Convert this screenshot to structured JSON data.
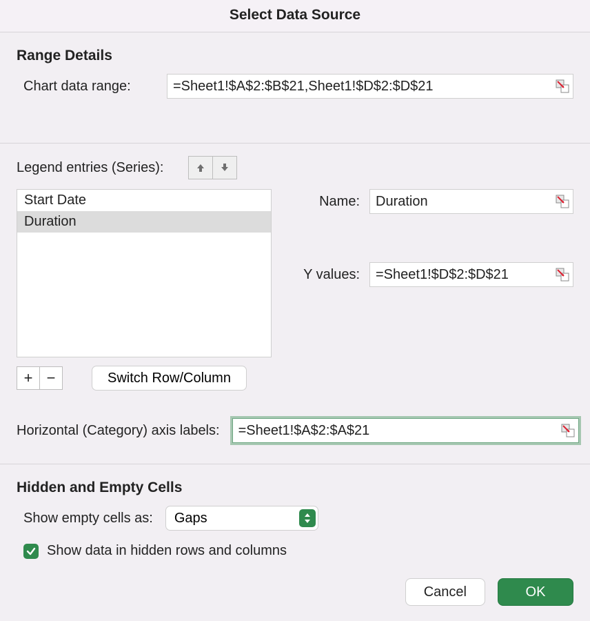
{
  "dialog": {
    "title": "Select Data Source"
  },
  "range_details": {
    "heading": "Range Details",
    "chart_data_range_label": "Chart data range:",
    "chart_data_range_value": "=Sheet1!$A$2:$B$21,Sheet1!$D$2:$D$21"
  },
  "legend": {
    "heading": "Legend entries (Series):",
    "items": [
      {
        "label": "Start Date",
        "selected": false
      },
      {
        "label": "Duration",
        "selected": true
      }
    ],
    "add_label": "+",
    "remove_label": "−",
    "switch_label": "Switch Row/Column"
  },
  "series": {
    "name_label": "Name:",
    "name_value": "Duration",
    "yvalues_label": "Y values:",
    "yvalues_value": "=Sheet1!$D$2:$D$21"
  },
  "axis": {
    "label": "Horizontal (Category) axis labels:",
    "value": "=Sheet1!$A$2:$A$21"
  },
  "hidden": {
    "heading": "Hidden and Empty Cells",
    "empty_label": "Show empty cells as:",
    "empty_value": "Gaps",
    "show_hidden_label": "Show data in hidden rows and columns",
    "show_hidden_checked": true
  },
  "footer": {
    "cancel": "Cancel",
    "ok": "OK"
  }
}
